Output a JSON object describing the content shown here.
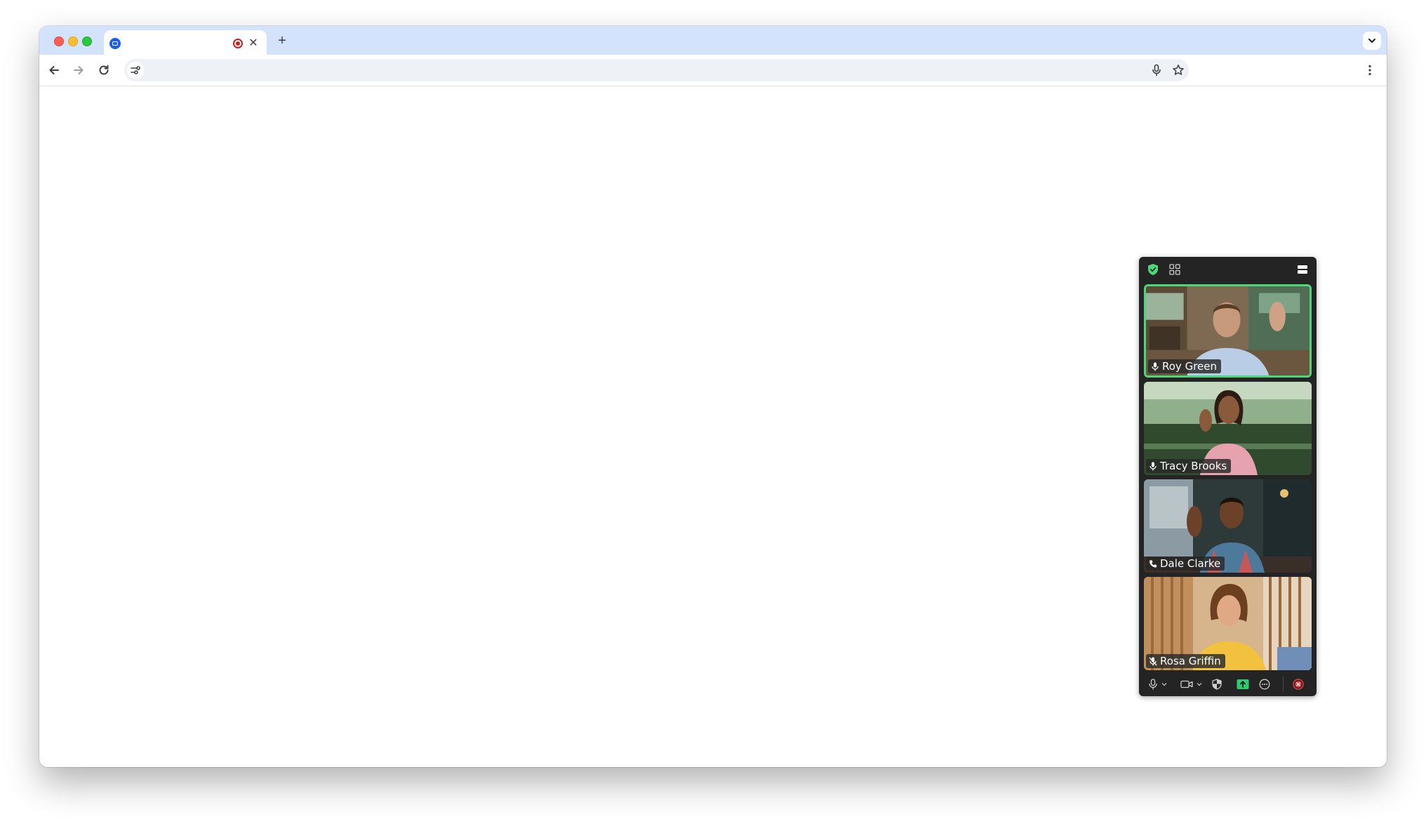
{
  "browser": {
    "tab": {
      "title": "",
      "recording": true
    },
    "address_bar": {
      "url": ""
    }
  },
  "meeting": {
    "participants": [
      {
        "name": "Roy Green",
        "audio": "mic-on",
        "active_speaker": true
      },
      {
        "name": "Tracy Brooks",
        "audio": "mic-on",
        "active_speaker": false
      },
      {
        "name": "Dale Clarke",
        "audio": "phone",
        "active_speaker": false
      },
      {
        "name": "Rosa Griffin",
        "audio": "mic-muted",
        "active_speaker": false
      }
    ],
    "colors": {
      "panel": "#242424",
      "accent_green": "#4fd67a",
      "end_red": "#e8383d"
    }
  }
}
